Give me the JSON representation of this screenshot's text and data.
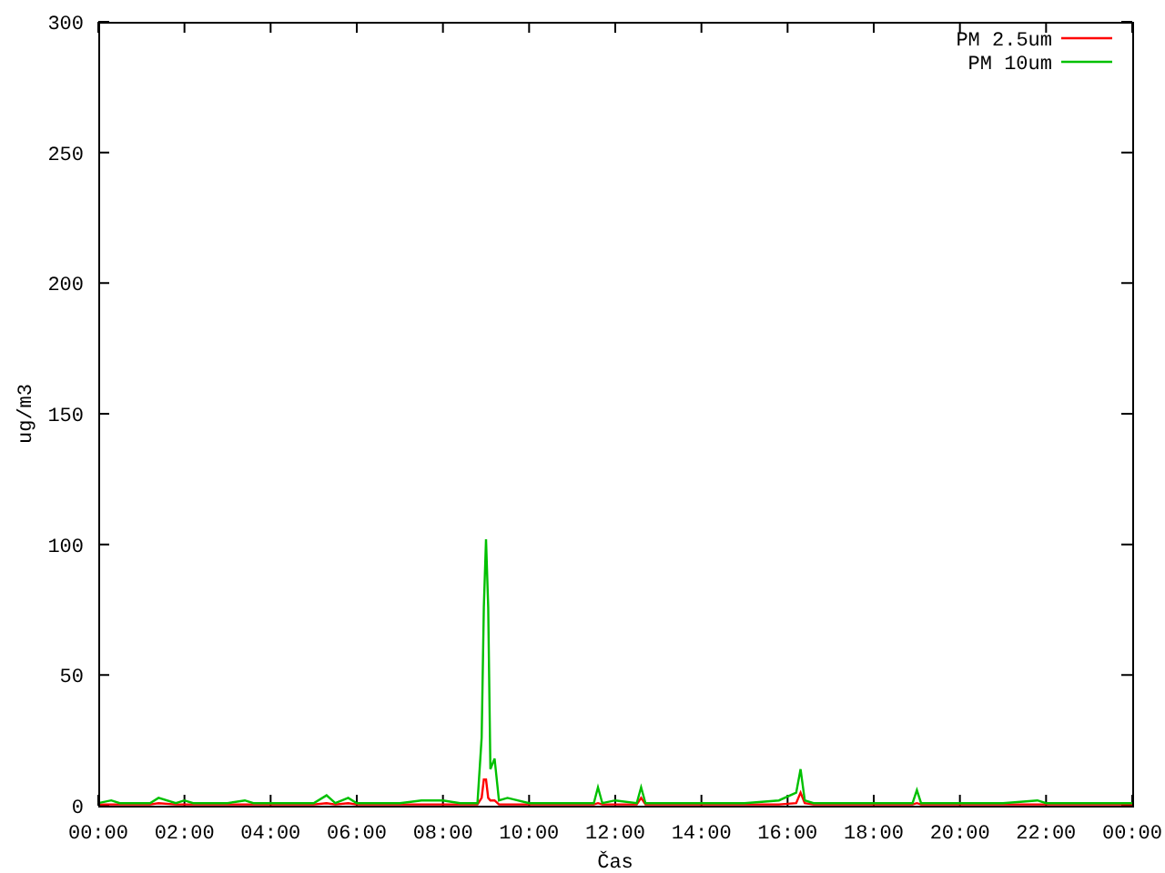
{
  "chart_data": {
    "type": "line",
    "legend": true,
    "xlabel": "Čas",
    "ylabel": "ug/m3",
    "xlim": [
      0,
      24
    ],
    "ylim": [
      0,
      300
    ],
    "yticks": [
      0,
      50,
      100,
      150,
      200,
      250,
      300
    ],
    "xticks": [
      {
        "value": 0,
        "label": "00:00"
      },
      {
        "value": 2,
        "label": "02:00"
      },
      {
        "value": 4,
        "label": "04:00"
      },
      {
        "value": 6,
        "label": "06:00"
      },
      {
        "value": 8,
        "label": "08:00"
      },
      {
        "value": 10,
        "label": "10:00"
      },
      {
        "value": 12,
        "label": "12:00"
      },
      {
        "value": 14,
        "label": "14:00"
      },
      {
        "value": 16,
        "label": "16:00"
      },
      {
        "value": 18,
        "label": "18:00"
      },
      {
        "value": 20,
        "label": "20:00"
      },
      {
        "value": 22,
        "label": "22:00"
      },
      {
        "value": 24,
        "label": "00:00"
      }
    ],
    "x": [
      0,
      0.3,
      0.5,
      0.8,
      1.2,
      1.4,
      1.8,
      2.0,
      2.2,
      3.0,
      3.4,
      3.6,
      4.0,
      5.0,
      5.3,
      5.5,
      5.8,
      6.0,
      6.4,
      7.0,
      7.5,
      8.0,
      8.4,
      8.8,
      8.9,
      8.95,
      9.0,
      9.05,
      9.1,
      9.2,
      9.3,
      9.5,
      10.0,
      10.5,
      11.0,
      11.5,
      11.6,
      11.7,
      12.0,
      12.5,
      12.6,
      12.7,
      13.0,
      14.0,
      15.0,
      15.8,
      16.2,
      16.3,
      16.4,
      16.6,
      17.0,
      18.0,
      18.9,
      19.0,
      19.1,
      20.0,
      21.0,
      21.8,
      22.0,
      23.0,
      24.0
    ],
    "series": [
      {
        "name": "PM 2.5um",
        "color": "#ff0000",
        "values": [
          0.5,
          0.5,
          0.5,
          0.5,
          0.5,
          1,
          0.5,
          0.5,
          0.5,
          0.5,
          0.5,
          0.5,
          0.5,
          0.5,
          1,
          0.5,
          1,
          0.5,
          0.5,
          0.5,
          0.5,
          0.5,
          0.5,
          0.5,
          3,
          10,
          10,
          3,
          2,
          2,
          0.5,
          0.5,
          0.5,
          0.5,
          0.5,
          0.5,
          1,
          0.5,
          0.5,
          0.5,
          3,
          0.5,
          0.5,
          0.5,
          0.5,
          0.5,
          1,
          5,
          1,
          0.5,
          0.5,
          0.5,
          0.5,
          1,
          0.5,
          0.5,
          0.5,
          0.5,
          0.5,
          0.5,
          0.5
        ]
      },
      {
        "name": "PM 10um",
        "color": "#00c000",
        "values": [
          1,
          2,
          1,
          1,
          1,
          3,
          1,
          2,
          1,
          1,
          2,
          1,
          1,
          1,
          4,
          1,
          3,
          1,
          1,
          1,
          2,
          2,
          1,
          1,
          26,
          76,
          102,
          76,
          14,
          18,
          2,
          3,
          1,
          1,
          1,
          1,
          7,
          1,
          2,
          1,
          7,
          1,
          1,
          1,
          1,
          2,
          5,
          14,
          2,
          1,
          1,
          1,
          1,
          6,
          1,
          1,
          1,
          2,
          1,
          1,
          1
        ]
      }
    ]
  }
}
